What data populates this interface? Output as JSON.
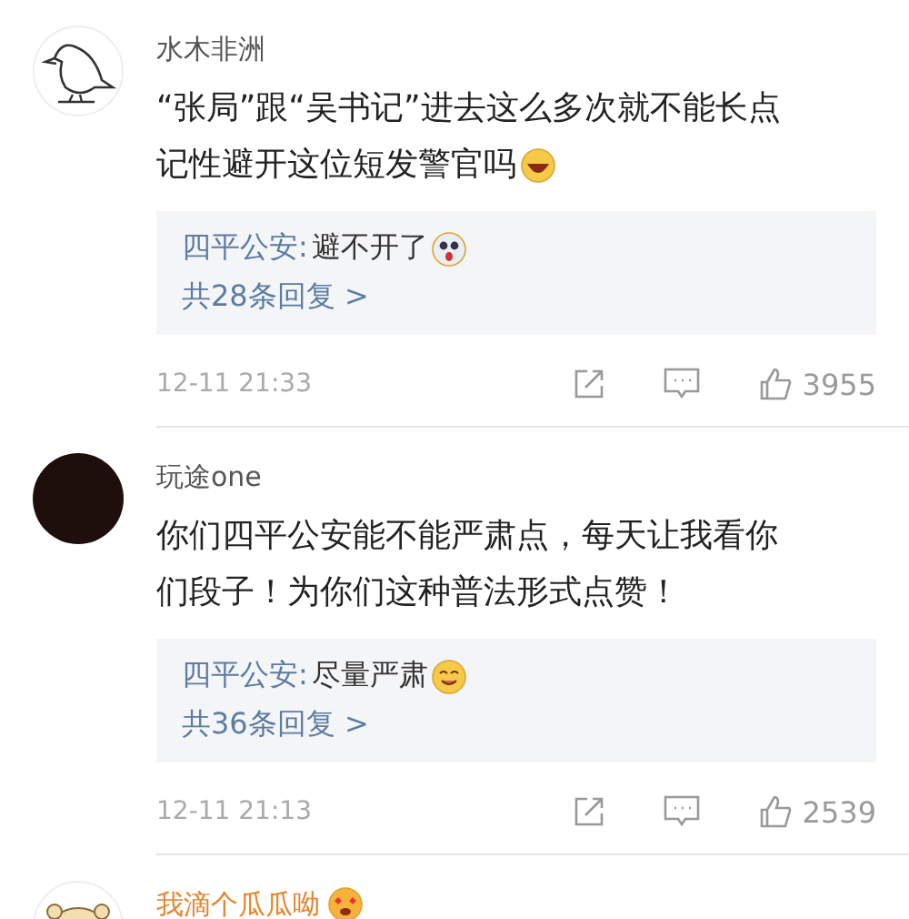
{
  "comments": [
    {
      "avatar": {
        "kind": "bird"
      },
      "name": "水木非洲",
      "vip": false,
      "lines": [
        "“张局”跟“吴书记”进去这么多次就不能长点",
        "记性避开这位短发警官吗"
      ],
      "emoji": {
        "kind": "laugh"
      },
      "reply": {
        "author": "四平公安:",
        "text": "避不开了",
        "emoji": {
          "kind": "shocked"
        },
        "more": "共28条回复 >"
      },
      "time": "12-11 21:33",
      "likes": "3955"
    },
    {
      "avatar": {
        "kind": "dark"
      },
      "name": "玩途one",
      "vip": false,
      "lines": [
        "你们四平公安能不能严肃点，每天让我看你",
        "们段子！为你们这种普法形式点赞！"
      ],
      "reply": {
        "author": "四平公安:",
        "text": "尽量严肃",
        "emoji": {
          "kind": "yum"
        },
        "more": "共36条回复 >"
      },
      "time": "12-11 21:13",
      "likes": "2539"
    },
    {
      "avatar": {
        "kind": "cartoon"
      },
      "name": "我滴个瓜瓜呦",
      "vip": true,
      "name_emoji": {
        "kind": "love"
      }
    }
  ]
}
